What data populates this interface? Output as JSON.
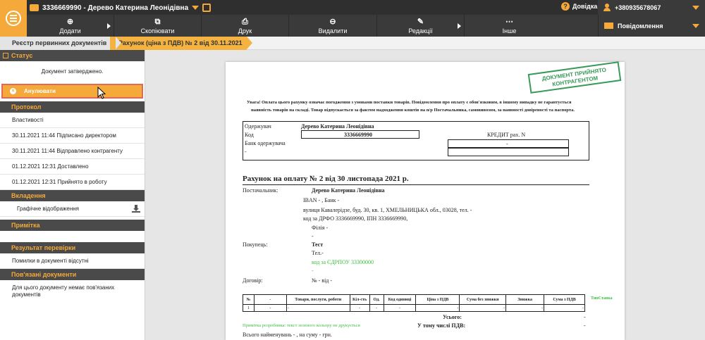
{
  "header": {
    "org_name": "3336669990 - Дерево Катерина Леонідівна",
    "help_label": "Довідка",
    "phone": "+380935678067",
    "notifications_label": "Повідомлення"
  },
  "toolbar": {
    "add": "Додати",
    "copy": "Скопіювати",
    "print": "Друк",
    "delete": "Видалити",
    "editions": "Редакції",
    "other": "Інше"
  },
  "breadcrumb": {
    "registry": "Реєстр первинних документів",
    "current": "Рахунок (ціна з ПДВ) № 2 від 30.11.2021"
  },
  "sidebar": {
    "status_title": "Статус",
    "status_text": "Документ затверджено.",
    "cancel_button": "Анулювати",
    "protocol_title": "Протокол",
    "protocol_items": [
      "Властивості",
      "30.11.2021 11:44  Підписано директором",
      "30.11.2021 11:44  Відправлено контрагенту",
      "01.12.2021 12:31  Доставлено",
      "01.12.2021 12:31  Прийнято в роботу"
    ],
    "attachments_title": "Вкладення",
    "attachments_item": "Графічне відображення",
    "note_title": "Примітка",
    "check_title": "Результат перевірки",
    "check_item": "Помилки в документі відсутні",
    "related_title": "Пов'язані документи",
    "related_text_1": "Для цього документу немає пов'язаних",
    "related_text_2": "документів"
  },
  "document": {
    "stamp_line1": "ДОКУМЕНТ ПРИЙНЯТО",
    "stamp_line2": "КОНТРАГЕНТОМ",
    "warning_1": "Увага! Оплата цього рахунку означає погодження з умовами поставки товарів. Повідомлення про оплату є обов'язковим, в іншому випадку не гарантується",
    "warning_2": "наявність товарів на складі. Товар відпускається за фактом надходження коштів на п/р Постачальника, самовивозом, за наявності довіреності та паспорта.",
    "recipient_label": "Одержувач",
    "recipient_name": "Дерево Катерина Леонідівна",
    "code_label": "Код",
    "code_value": "3336669990",
    "credit_label": "КРЕДИТ рах. N",
    "credit_value": "-",
    "bank_label": "Банк одержувача",
    "bank_value": "-",
    "title": "Рахунок на оплату № 2    від 30 листопада 2021 р.",
    "supplier_label": "Постачальник:",
    "supplier_name": "Дерево Катерина Леонідівна",
    "supplier_iban": "IBAN -       , Банк -",
    "supplier_address": "вулиця Кавалерідзе, буд. 30, кв. 1, ХМЕЛЬНИЦЬКА обл., 03028, тел. -",
    "supplier_tax": "код за ДРФО 3336669990, ІПН 3336669990,",
    "supplier_branch": "Філія -",
    "supplier_dash": "-",
    "buyer_label": "Покупець:",
    "buyer_name": "Тест",
    "buyer_phone": "Тел.-",
    "buyer_code": "код за ЄДРПОУ 33300000",
    "buyer_dash": "-",
    "contract_label": "Договір:",
    "contract_value": "№    -        від    -",
    "table_headers": [
      "№",
      "-",
      "Товари, послуги, роботи",
      "Кіл-сть",
      "Од.",
      "Код одиниці",
      "Ціна з ПДВ",
      "Сума без знижки",
      "Знижка",
      "Сума з ПДВ"
    ],
    "table_row": [
      "1",
      "-",
      "-",
      "-",
      "-",
      "-",
      "-",
      "-",
      "-",
      "-"
    ],
    "tax_rate_label": "ТипСтавка",
    "total_label": "Усього:",
    "total_value": "-",
    "vat_label": "У тому числі ПДВ:",
    "vat_value": "-",
    "dev_note": "Примітка розробника: текст зеленого кольору не друкується",
    "items_summary": "Всього найменувань  -    , на суму  -         грн."
  }
}
